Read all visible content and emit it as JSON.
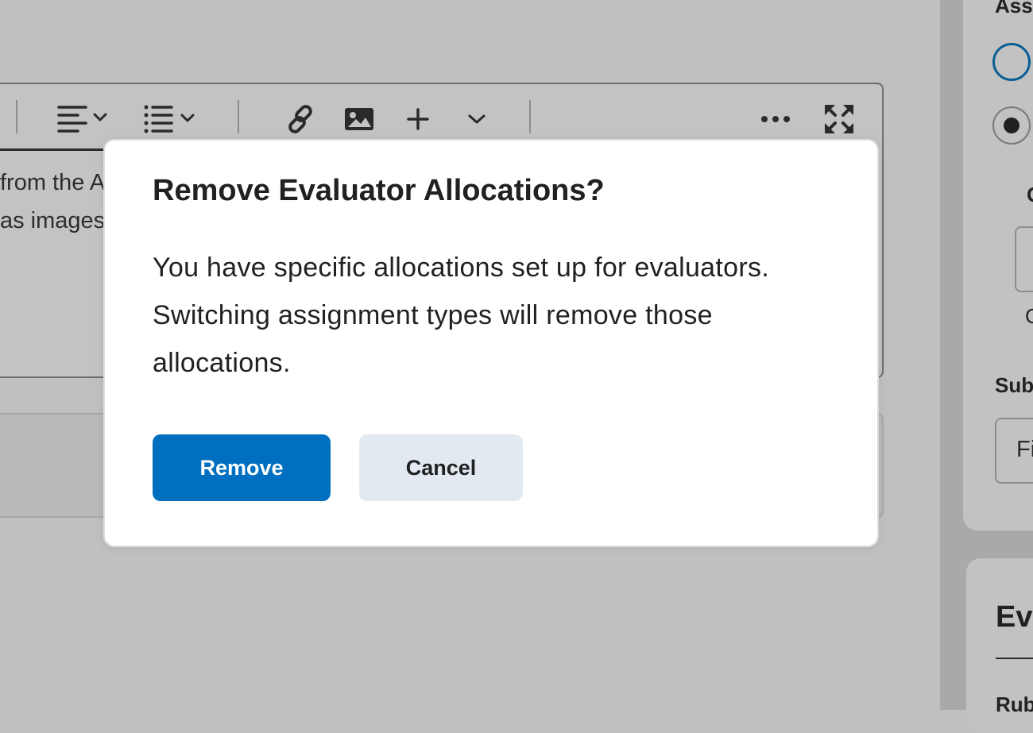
{
  "background_editor": {
    "text_line_1": "from the A",
    "text_line_2": "as images",
    "toolbar": {
      "align_icon": "align-left-icon",
      "list_icon": "bulleted-list-icon",
      "link_icon": "link-icon",
      "image_icon": "image-icon",
      "insert_icon": "plus-icon",
      "more_insert_icon": "chevron-down-icon",
      "overflow_icon": "ellipsis-icon",
      "fullscreen_icon": "fullscreen-icon"
    }
  },
  "sidebar": {
    "assignment_type_heading": "Assi",
    "radio_option_1_selected": false,
    "radio_option_2_selected": true,
    "sub_label_1": "G",
    "sub_label_2": "G",
    "submission_heading": "Sub",
    "submission_value": "Fi",
    "evaluation_heading": "Eva",
    "rubrics_heading": "Rub"
  },
  "dialog": {
    "title": "Remove Evaluator Allocations?",
    "body": "You have specific allocations set up for evaluators. Switching assignment types will remove those allocations.",
    "primary_button": "Remove",
    "secondary_button": "Cancel"
  },
  "colors": {
    "overlay_gray": "#c0c0c0",
    "primary_blue": "#006fbf",
    "secondary_button_bg": "#e3e9f1",
    "radio_outline_blue": "#0a5e96"
  }
}
